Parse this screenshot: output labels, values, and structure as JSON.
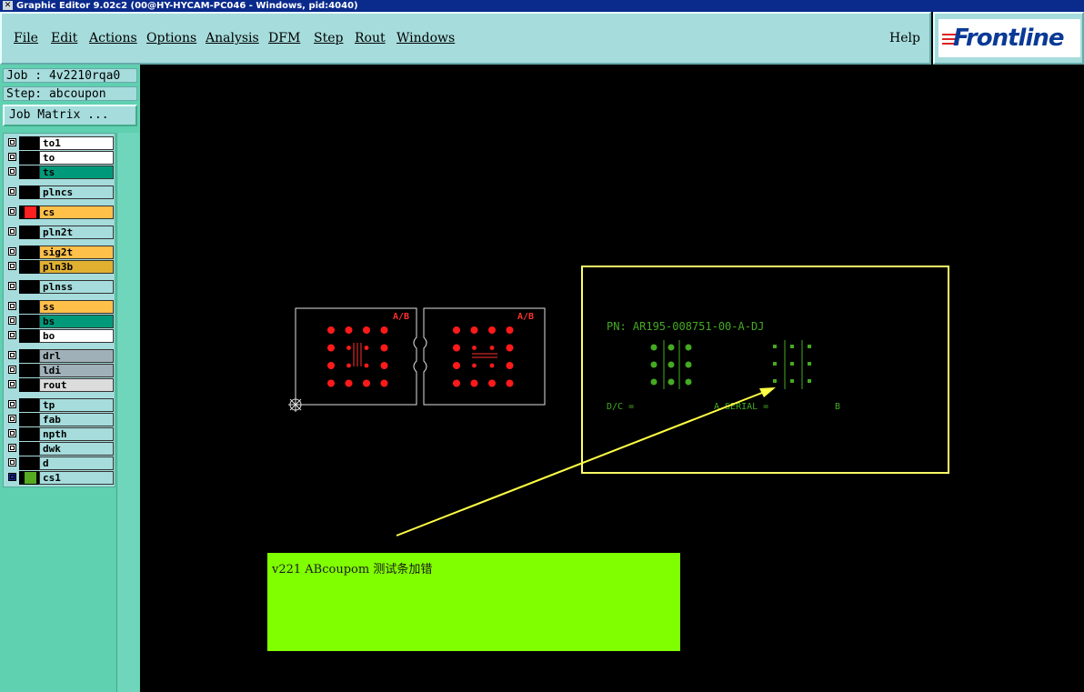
{
  "window": {
    "title": "Graphic Editor 9.02c2 (00@HY-HYCAM-PC046 - Windows, pid:4040)"
  },
  "menu": {
    "items": [
      "File",
      "Edit",
      "Actions",
      "Options",
      "Analysis",
      "DFM",
      "Step",
      "Rout",
      "Windows"
    ],
    "help": "Help"
  },
  "brand": {
    "logo_text": "Frontline",
    "color": "#0a3a96"
  },
  "job": {
    "label": "Job : 4v2210rqa0",
    "step": "Step: abcoupon",
    "matrix_button": "Job Matrix ..."
  },
  "layers": [
    {
      "name": "to1",
      "color": "#ffffff"
    },
    {
      "name": "to",
      "color": "#ffffff"
    },
    {
      "name": "ts",
      "color": "#009a7a"
    },
    {
      "name": "plncs",
      "color": "#a6dcdc"
    },
    {
      "name": "cs",
      "color": "#ffc04a",
      "active_swatch": "#ff2020"
    },
    {
      "name": "pln2t",
      "color": "#a6dcdc"
    },
    {
      "name": "sig2t",
      "color": "#ffc04a"
    },
    {
      "name": "pln3b",
      "color": "#e0b030"
    },
    {
      "name": "plnss",
      "color": "#a6dcdc"
    },
    {
      "name": "ss",
      "color": "#ffc04a"
    },
    {
      "name": "bs",
      "color": "#009a7a"
    },
    {
      "name": "bo",
      "color": "#ffffff"
    },
    {
      "name": "drl",
      "color": "#a0b0b8"
    },
    {
      "name": "ldi",
      "color": "#a0b0b8"
    },
    {
      "name": "rout",
      "color": "#dcdcdc"
    },
    {
      "name": "tp",
      "color": "#a6dcdc"
    },
    {
      "name": "fab",
      "color": "#a6dcdc"
    },
    {
      "name": "npth",
      "color": "#a6dcdc"
    },
    {
      "name": "dwk",
      "color": "#a6dcdc"
    },
    {
      "name": "d",
      "color": "#a6dcdc"
    },
    {
      "name": "cs1",
      "color": "#a6dcdc",
      "active_swatch": "#55aa22",
      "checkbox_color": "#1a2a9a"
    }
  ],
  "canvas": {
    "coupon_label": "A/B",
    "pn_text": "PN: AR195-008751-00-A-DJ",
    "dc_text": "D/C =",
    "serial_text": "A SERIAL =",
    "b_text": "B"
  },
  "note": {
    "text": "v221 ABcoupom 测试条加错"
  }
}
